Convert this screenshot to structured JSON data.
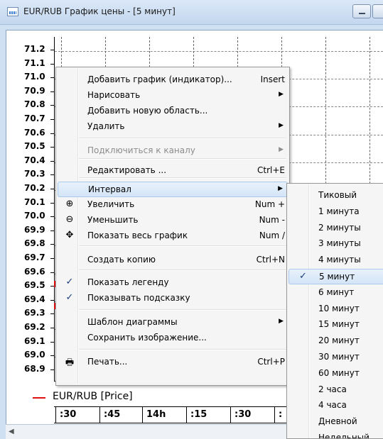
{
  "window": {
    "title": "EUR/RUB График цены - [5 минут]"
  },
  "chart": {
    "y_labels": [
      "71.2",
      "71.1",
      "71.0",
      "70.9",
      "70.8",
      "70.7",
      "70.6",
      "70.5",
      "70.4",
      "70.3",
      "70.2",
      "70.1",
      "70.0",
      "69.9",
      "69.8",
      "69.7",
      "69.6",
      "69.5",
      "69.4",
      "69.3",
      "69.2",
      "69.1",
      "69.0",
      "68.9"
    ],
    "x_labels": [
      ":30",
      ":45",
      "14h",
      ":15",
      ":30",
      ":"
    ],
    "legend": "EUR/RUB [Price]",
    "series_color": "#dd1111"
  },
  "context_menu": {
    "items": [
      {
        "label": "Добавить график (индикатор)...",
        "shortcut": "Insert"
      },
      {
        "label": "Нарисовать",
        "submenu": "▶"
      },
      {
        "label": "Добавить новую область..."
      },
      {
        "label": "Удалить",
        "submenu": "▶"
      },
      {
        "label": "Подключиться к каналу",
        "submenu": "▶",
        "disabled": true
      },
      {
        "label": "Редактировать ...",
        "shortcut": "Ctrl+E"
      },
      {
        "label": "Интервал",
        "submenu": "▶",
        "highlighted": true
      },
      {
        "label": "Увеличить",
        "shortcut": "Num +",
        "icon": "⊕"
      },
      {
        "label": "Уменьшить",
        "shortcut": "Num -",
        "icon": "⊖"
      },
      {
        "label": "Показать весь график",
        "shortcut": "Num /",
        "icon": "✥"
      },
      {
        "label": "Создать копию",
        "shortcut": "Ctrl+N"
      },
      {
        "label": "Показать легенду",
        "check": "✓"
      },
      {
        "label": "Показывать подсказку",
        "check": "✓"
      },
      {
        "label": "Шаблон диаграммы",
        "submenu": "▶"
      },
      {
        "label": "Сохранить изображение..."
      },
      {
        "label": "Печать...",
        "shortcut": "Ctrl+P",
        "icon": "🖶"
      }
    ]
  },
  "interval_submenu": {
    "check": "✓",
    "items": [
      "Тиковый",
      "1 минута",
      "2 минуты",
      "3 минуты",
      "4 минуты",
      "5 минут",
      "6 минут",
      "10 минут",
      "15 минут",
      "20 минут",
      "30 минут",
      "60 минут",
      "2 часа",
      "4 часа",
      "Дневной",
      "Недельный"
    ],
    "selected": "5 минут"
  }
}
